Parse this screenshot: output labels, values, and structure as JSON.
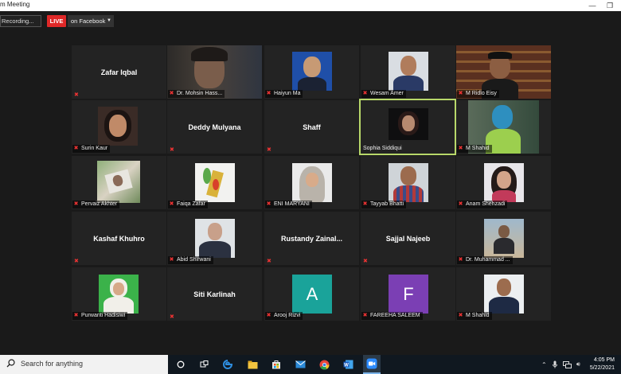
{
  "window": {
    "title": "m Meeting"
  },
  "topbar": {
    "recording": "Recording...",
    "live": "LIVE",
    "stream_target": "on Facebook"
  },
  "participants": [
    {
      "name": "Zafar Iqbal",
      "display": "name"
    },
    {
      "name": "Dr. Mohsin Hass...",
      "display": "video"
    },
    {
      "name": "Haiyun Ma",
      "display": "video"
    },
    {
      "name": "Wesam Amer",
      "display": "video"
    },
    {
      "name": "M Ridlo Eisy",
      "display": "video"
    },
    {
      "name": "Surin Kaur",
      "display": "video"
    },
    {
      "name": "Deddy Mulyana",
      "display": "name"
    },
    {
      "name": "Shaff",
      "display": "name"
    },
    {
      "name": "Sophia Siddiqui",
      "display": "video",
      "active_speaker": true
    },
    {
      "name": "M Shahid",
      "display": "video"
    },
    {
      "name": "Pervaiz Akhter",
      "display": "video"
    },
    {
      "name": "Faiqa Zafar",
      "display": "video"
    },
    {
      "name": "ENI MARYANI",
      "display": "video"
    },
    {
      "name": "Tayyab Bhatti",
      "display": "video"
    },
    {
      "name": "Anam Shehzadi",
      "display": "video"
    },
    {
      "name": "Kashaf Khuhro",
      "display": "name"
    },
    {
      "name": "Abid Shirwani",
      "display": "video"
    },
    {
      "name": "Rustandy  Zainal...",
      "display": "name"
    },
    {
      "name": "Sajjal Najeeb",
      "display": "name"
    },
    {
      "name": "Dr. Muhammad ...",
      "display": "video"
    },
    {
      "name": "Purwanti Hadisiwi",
      "display": "video"
    },
    {
      "name": "Siti Karlinah",
      "display": "name"
    },
    {
      "name": "Arooj Rizvi",
      "display": "avatar",
      "initial": "A",
      "color": "#1aa39a"
    },
    {
      "name": "FAREEHA SALEEM",
      "display": "avatar",
      "initial": "F",
      "color": "#7b3fb4"
    },
    {
      "name": "M Shahid",
      "display": "video"
    }
  ],
  "taskbar": {
    "search_placeholder": "Search for anything",
    "time": "4:05 PM",
    "date": "5/22/2021"
  }
}
